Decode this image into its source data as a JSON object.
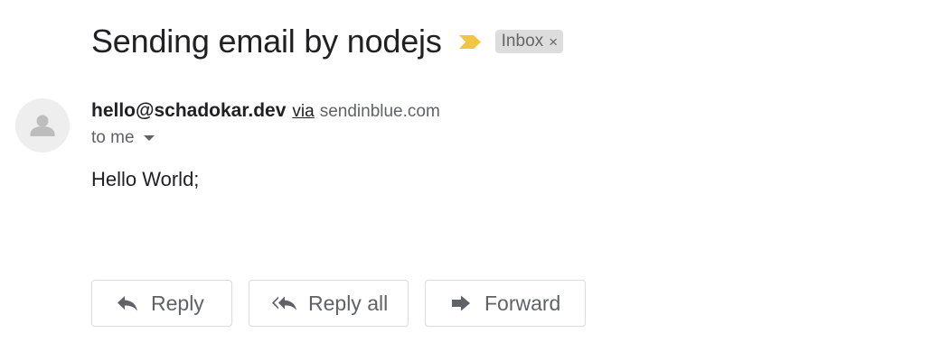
{
  "message": {
    "subject": "Sending email by nodejs",
    "label": "Inbox",
    "label_close_glyph": "×",
    "importance_color": "#f4c542",
    "sender_email": "hello@schadokar.dev",
    "via_label": "via",
    "via_domain": "sendinblue.com",
    "recipient_text": "to me",
    "body": "Hello World;"
  },
  "actions": {
    "reply_label": "Reply",
    "reply_all_label": "Reply all",
    "forward_label": "Forward"
  },
  "icons": {
    "importance": "importance-marker-icon",
    "avatar": "person-avatar-icon",
    "recipient_details": "caret-down-icon",
    "reply": "reply-arrow-icon",
    "reply_all": "reply-all-arrow-icon",
    "forward": "forward-arrow-icon"
  }
}
